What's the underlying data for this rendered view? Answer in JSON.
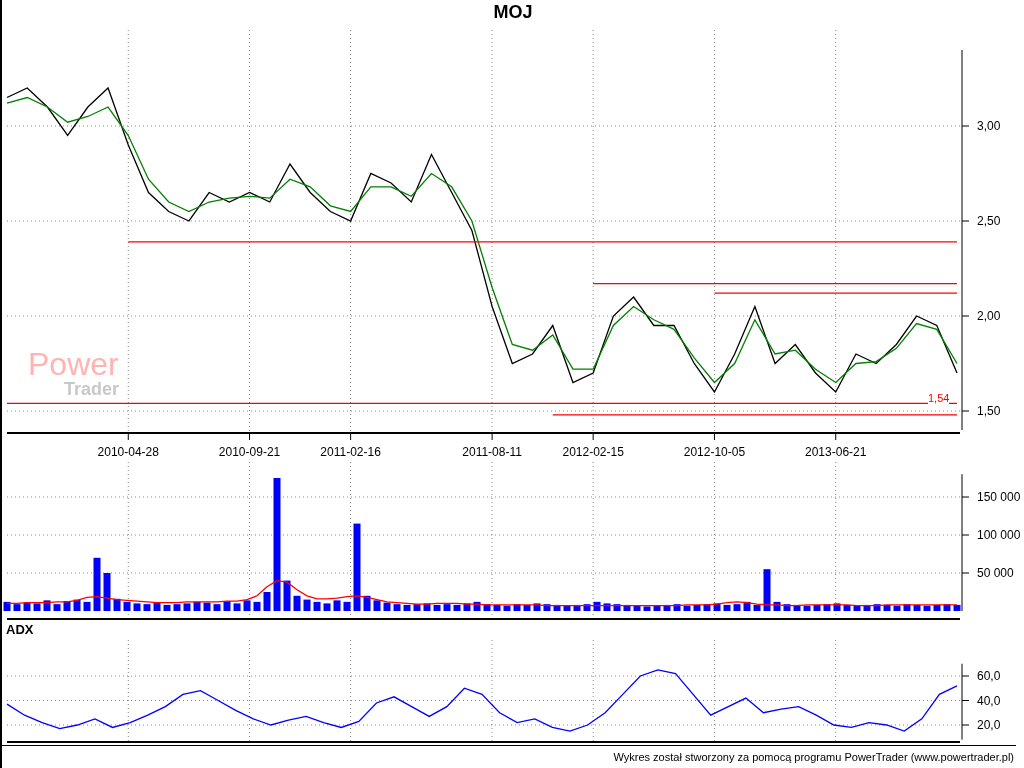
{
  "title": "MOJ",
  "logo": {
    "line_1": "Power",
    "line_2": "Trader"
  },
  "price_chart": {
    "chart_data": {
      "type": "line",
      "grid": true,
      "ylim": [
        1.4,
        3.4
      ],
      "categories": [
        null,
        null,
        null,
        null,
        null,
        null,
        "2010-04-28",
        null,
        null,
        null,
        null,
        null,
        "2010-09-21",
        null,
        null,
        null,
        null,
        "2011-02-16",
        null,
        null,
        null,
        null,
        null,
        null,
        "2011-08-11",
        null,
        null,
        null,
        null,
        "2012-02-15",
        null,
        null,
        null,
        null,
        null,
        "2012-10-05",
        null,
        null,
        null,
        null,
        null,
        "2013-06-21",
        null,
        null,
        null,
        null,
        null,
        null
      ],
      "yticks": [
        {
          "value": 1.5,
          "label": "1,50"
        },
        {
          "value": 2.0,
          "label": "2,00"
        },
        {
          "value": 2.5,
          "label": "2,50"
        },
        {
          "value": 3.0,
          "label": "3,00"
        }
      ],
      "series": [
        {
          "color": "#000000",
          "values": [
            3.15,
            3.2,
            3.1,
            2.95,
            3.1,
            3.2,
            2.9,
            2.65,
            2.55,
            2.5,
            2.65,
            2.6,
            2.65,
            2.6,
            2.8,
            2.65,
            2.55,
            2.5,
            2.75,
            2.7,
            2.6,
            2.85,
            2.65,
            2.45,
            2.05,
            1.75,
            1.8,
            1.95,
            1.65,
            1.7,
            2.0,
            2.1,
            1.95,
            1.95,
            1.75,
            1.6,
            1.8,
            2.05,
            1.75,
            1.85,
            1.7,
            1.6,
            1.8,
            1.75,
            1.85,
            2.0,
            1.95,
            1.7
          ]
        },
        {
          "color": "#008000",
          "values": [
            3.12,
            3.15,
            3.1,
            3.02,
            3.05,
            3.1,
            2.95,
            2.72,
            2.6,
            2.55,
            2.6,
            2.62,
            2.63,
            2.62,
            2.72,
            2.68,
            2.58,
            2.55,
            2.68,
            2.68,
            2.63,
            2.75,
            2.68,
            2.5,
            2.15,
            1.85,
            1.82,
            1.9,
            1.72,
            1.72,
            1.95,
            2.05,
            1.98,
            1.93,
            1.78,
            1.65,
            1.75,
            1.98,
            1.8,
            1.82,
            1.72,
            1.65,
            1.75,
            1.76,
            1.83,
            1.96,
            1.93,
            1.75
          ]
        },
        {
          "color": "#ff0000",
          "values": [
            null,
            null,
            null,
            null,
            null,
            null,
            2.39,
            2.39,
            2.39,
            2.39,
            2.39,
            2.39,
            2.39,
            2.39,
            2.39,
            2.39,
            2.39,
            2.39,
            2.39,
            2.39,
            2.39,
            2.39,
            2.39,
            2.39,
            2.39,
            2.39,
            2.39,
            2.39,
            2.39,
            2.39,
            2.39,
            2.39,
            2.39,
            2.39,
            2.39,
            2.39,
            2.39,
            2.39,
            2.39,
            2.39,
            2.39,
            2.39,
            2.39,
            2.39,
            2.39,
            2.39,
            2.39,
            2.39
          ]
        },
        {
          "color": "#ff0000",
          "values": [
            null,
            null,
            null,
            null,
            null,
            null,
            null,
            null,
            null,
            null,
            null,
            null,
            null,
            null,
            null,
            null,
            null,
            null,
            null,
            null,
            null,
            null,
            null,
            null,
            null,
            null,
            null,
            null,
            null,
            2.17,
            2.17,
            2.17,
            2.17,
            2.17,
            2.17,
            2.17,
            2.17,
            2.17,
            2.17,
            2.17,
            2.17,
            2.17,
            2.17,
            2.17,
            2.17,
            2.17,
            2.17,
            2.17
          ]
        },
        {
          "color": "#ff0000",
          "values": [
            null,
            null,
            null,
            null,
            null,
            null,
            null,
            null,
            null,
            null,
            null,
            null,
            null,
            null,
            null,
            null,
            null,
            null,
            null,
            null,
            null,
            null,
            null,
            null,
            null,
            null,
            null,
            null,
            null,
            null,
            null,
            null,
            null,
            null,
            null,
            2.12,
            2.12,
            2.12,
            2.12,
            2.12,
            2.12,
            2.12,
            2.12,
            2.12,
            2.12,
            2.12,
            2.12,
            2.12
          ]
        },
        {
          "color": "#ff0000",
          "values": [
            1.54,
            1.54,
            1.54,
            1.54,
            1.54,
            1.54,
            1.54,
            1.54,
            1.54,
            1.54,
            1.54,
            1.54,
            1.54,
            1.54,
            1.54,
            1.54,
            1.54,
            1.54,
            1.54,
            1.54,
            1.54,
            1.54,
            1.54,
            1.54,
            1.54,
            1.54,
            1.54,
            1.54,
            1.54,
            1.54,
            1.54,
            1.54,
            1.54,
            1.54,
            1.54,
            1.54,
            1.54,
            1.54,
            1.54,
            1.54,
            1.54,
            1.54,
            1.54,
            1.54,
            1.54,
            1.54,
            1.54,
            1.54
          ]
        },
        {
          "color": "#ff0000",
          "values": [
            null,
            null,
            null,
            null,
            null,
            null,
            null,
            null,
            null,
            null,
            null,
            null,
            null,
            null,
            null,
            null,
            null,
            null,
            null,
            null,
            null,
            null,
            null,
            null,
            null,
            null,
            null,
            1.48,
            1.48,
            1.48,
            1.48,
            1.48,
            1.48,
            1.48,
            1.48,
            1.48,
            1.48,
            1.48,
            1.48,
            1.48,
            1.48,
            1.48,
            1.48,
            1.48,
            1.48,
            1.48,
            1.48,
            1.48
          ]
        }
      ],
      "annotations": [
        "1,54"
      ]
    }
  },
  "volume_chart": {
    "chart_data": {
      "type": "bar",
      "grid": true,
      "ylim": [
        0,
        180000
      ],
      "yticks": [
        {
          "value": 50000,
          "label": "50 000"
        },
        {
          "value": 100000,
          "label": "100 000"
        },
        {
          "value": 150000,
          "label": "150 000"
        }
      ],
      "series": [
        {
          "color": "#0000ff",
          "values": [
            12000,
            9000,
            11000,
            10000,
            14000,
            9000,
            13000,
            15000,
            12000,
            70000,
            50000,
            16000,
            12000,
            10000,
            9000,
            11000,
            8000,
            9000,
            10000,
            12000,
            11000,
            9000,
            13000,
            10000,
            14000,
            12000,
            25000,
            175000,
            40000,
            20000,
            15000,
            12000,
            10000,
            14000,
            12000,
            115000,
            20000,
            14000,
            11000,
            9000,
            8000,
            9000,
            10000,
            8000,
            9000,
            8000,
            10000,
            12000,
            9000,
            8000,
            7000,
            9000,
            8000,
            10000,
            9000,
            8000,
            7000,
            8000,
            9000,
            12000,
            10000,
            9000,
            8000,
            7000,
            6000,
            7000,
            8000,
            9000,
            7000,
            8000,
            9000,
            10000,
            8000,
            9000,
            12000,
            8000,
            55000,
            12000,
            9000,
            8000,
            7000,
            8000,
            9000,
            10000,
            8000,
            7000,
            8000,
            9000,
            8000,
            7000,
            9000,
            8000,
            7000,
            8000,
            9000,
            8000
          ]
        },
        {
          "type": "line",
          "color": "#ff0000",
          "values": [
            10000,
            10000,
            11000,
            11000,
            11000,
            12000,
            12000,
            14000,
            18000,
            19000,
            17000,
            15000,
            14000,
            13000,
            12000,
            11000,
            11000,
            11000,
            12000,
            12000,
            12000,
            12000,
            13000,
            13000,
            15000,
            20000,
            32000,
            40000,
            38000,
            28000,
            20000,
            16000,
            16000,
            17000,
            19000,
            20000,
            18000,
            15000,
            12000,
            11000,
            10000,
            9000,
            9000,
            10000,
            10000,
            10000,
            9000,
            9000,
            8000,
            8000,
            8000,
            8000,
            8000,
            8000,
            7000,
            7000,
            7000,
            7000,
            7000,
            7000,
            7000,
            7000,
            7000,
            7000,
            7000,
            7000,
            7000,
            7000,
            8000,
            8000,
            8000,
            9000,
            11000,
            12000,
            11000,
            9000,
            8000,
            8000,
            7000,
            7000,
            8000,
            8000,
            8000,
            8000,
            8000,
            7000,
            7000,
            7000,
            8000,
            8000,
            8000,
            8000,
            8000,
            8000,
            8000,
            8000
          ]
        }
      ]
    }
  },
  "adx_chart": {
    "label": "ADX",
    "chart_data": {
      "type": "line",
      "grid": true,
      "ylim": [
        8,
        70
      ],
      "yticks": [
        {
          "value": 20,
          "label": "20,0"
        },
        {
          "value": 40,
          "label": "40,0"
        },
        {
          "value": 60,
          "label": "60,0"
        }
      ],
      "series": [
        {
          "color": "#0000ff",
          "values": [
            37,
            28,
            22,
            17,
            20,
            25,
            18,
            22,
            28,
            35,
            45,
            48,
            40,
            32,
            25,
            20,
            24,
            27,
            22,
            18,
            23,
            38,
            43,
            35,
            27,
            35,
            50,
            45,
            30,
            22,
            25,
            18,
            15,
            20,
            30,
            45,
            60,
            65,
            62,
            45,
            28,
            35,
            42,
            30,
            33,
            35,
            28,
            20,
            18,
            22,
            20,
            15,
            25,
            45,
            52
          ]
        }
      ]
    }
  },
  "footer": "Wykres został stworzony za pomocą programu PowerTrader (www.powertrader.pl)"
}
